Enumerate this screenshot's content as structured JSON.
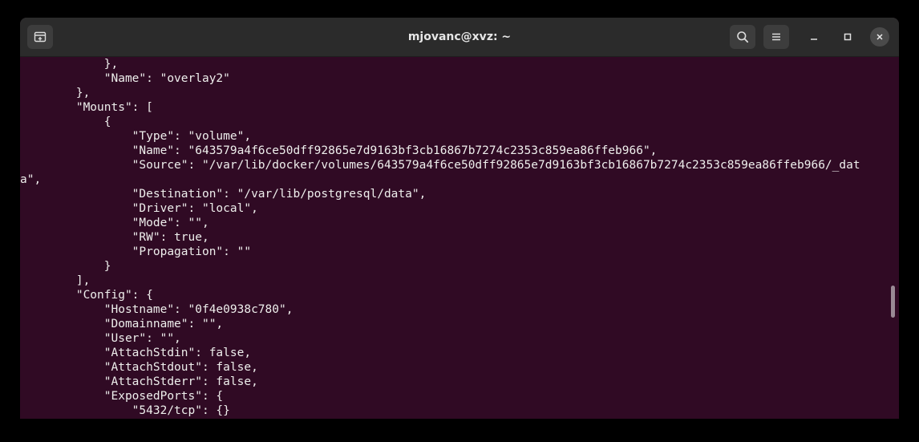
{
  "window": {
    "title": "mjovanc@xvz: ~"
  },
  "toolbar": {
    "new_tab_icon": "new-tab-icon",
    "search_icon": "search-icon",
    "menu_icon": "hamburger-menu-icon",
    "minimize_icon": "minimize-icon",
    "maximize_icon": "maximize-icon",
    "close_icon": "close-icon"
  },
  "colors": {
    "terminal_bg": "#300a24",
    "titlebar_bg": "#2b2b2b",
    "text": "#eeeeec"
  },
  "terminal": {
    "lines": [
      "            },",
      "            \"Name\": \"overlay2\"",
      "        },",
      "        \"Mounts\": [",
      "            {",
      "                \"Type\": \"volume\",",
      "                \"Name\": \"643579a4f6ce50dff92865e7d9163bf3cb16867b7274c2353c859ea86ffeb966\",",
      "                \"Source\": \"/var/lib/docker/volumes/643579a4f6ce50dff92865e7d9163bf3cb16867b7274c2353c859ea86ffeb966/_dat",
      "a\",",
      "                \"Destination\": \"/var/lib/postgresql/data\",",
      "                \"Driver\": \"local\",",
      "                \"Mode\": \"\",",
      "                \"RW\": true,",
      "                \"Propagation\": \"\"",
      "            }",
      "        ],",
      "        \"Config\": {",
      "            \"Hostname\": \"0f4e0938c780\",",
      "            \"Domainname\": \"\",",
      "            \"User\": \"\",",
      "            \"AttachStdin\": false,",
      "            \"AttachStdout\": false,",
      "            \"AttachStderr\": false,",
      "            \"ExposedPorts\": {",
      "                \"5432/tcp\": {}"
    ]
  }
}
